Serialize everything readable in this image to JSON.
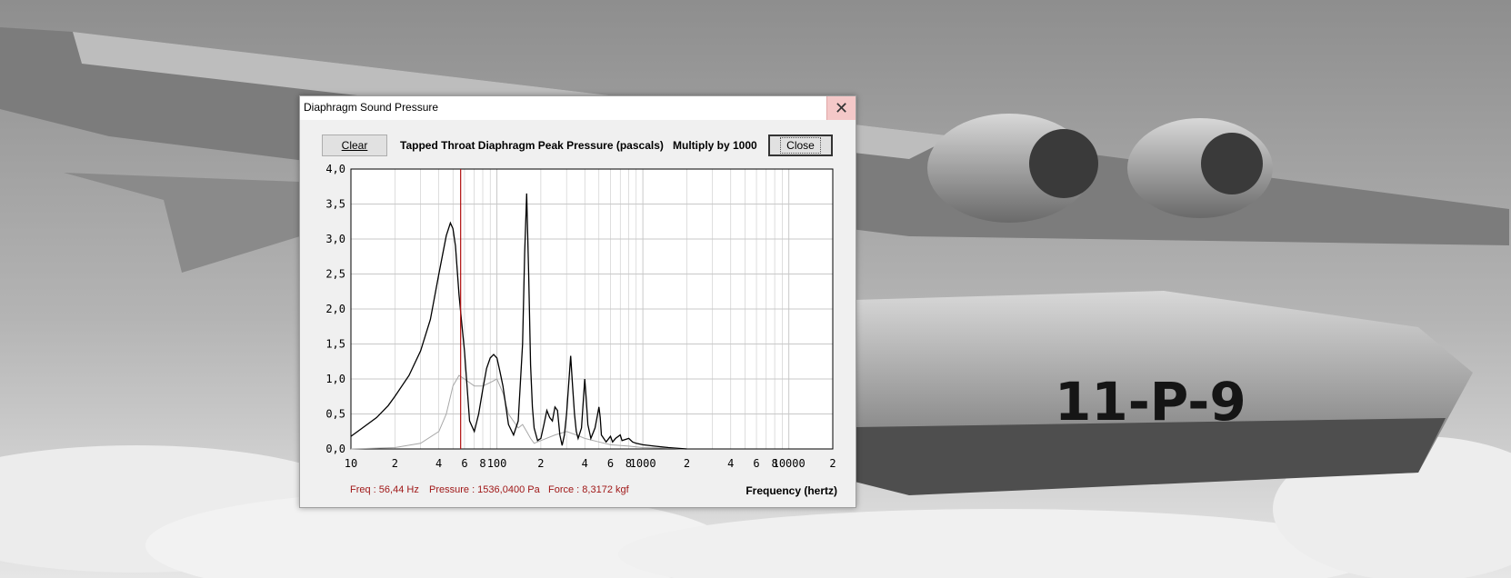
{
  "window": {
    "title": "Diaphragm Sound Pressure",
    "close_glyph": "✕"
  },
  "toolbar": {
    "clear_label": "Clear",
    "close_label": "Close",
    "chart_title": "Tapped Throat Diaphragm Peak Pressure (pascals)",
    "multiply_note": "Multiply by 1000"
  },
  "readouts": {
    "freq": "Freq : 56,44 Hz",
    "pressure": "Pressure : 1536,0400 Pa",
    "force": "Force : 8,3172 kgf"
  },
  "background": {
    "aircraft_marking": "11-P-9"
  },
  "chart_data": {
    "type": "line",
    "xscale": "log",
    "xlabel": "Frequency (hertz)",
    "xlim": [
      10,
      20000
    ],
    "ylim": [
      0,
      4
    ],
    "yticks": [
      "0,0",
      "0,5",
      "1,0",
      "1,5",
      "2,0",
      "2,5",
      "3,0",
      "3,5",
      "4,0"
    ],
    "yticks_values": [
      0,
      0.5,
      1,
      1.5,
      2,
      2.5,
      3,
      3.5,
      4
    ],
    "xticks": [
      {
        "v": 10,
        "label": "10"
      },
      {
        "v": 20,
        "label": "2"
      },
      {
        "v": 40,
        "label": "4"
      },
      {
        "v": 60,
        "label": "6"
      },
      {
        "v": 80,
        "label": "8"
      },
      {
        "v": 100,
        "label": "100"
      },
      {
        "v": 200,
        "label": "2"
      },
      {
        "v": 400,
        "label": "4"
      },
      {
        "v": 600,
        "label": "6"
      },
      {
        "v": 800,
        "label": "8"
      },
      {
        "v": 1000,
        "label": "1000"
      },
      {
        "v": 2000,
        "label": "2"
      },
      {
        "v": 4000,
        "label": "4"
      },
      {
        "v": 6000,
        "label": "6"
      },
      {
        "v": 8000,
        "label": "8"
      },
      {
        "v": 10000,
        "label": "10000"
      },
      {
        "v": 20000,
        "label": "2"
      }
    ],
    "cursor_freq": 56.44,
    "colors": {
      "main": "#000000",
      "secondary": "#a8a8a8",
      "cursor": "#b01010",
      "grid": "#c8c8c8"
    },
    "series": [
      {
        "color": "#000000",
        "x": [
          10,
          12,
          15,
          18,
          20,
          25,
          30,
          35,
          40,
          45,
          48,
          50,
          52,
          55,
          58,
          60,
          65,
          70,
          75,
          80,
          85,
          90,
          95,
          100,
          105,
          110,
          120,
          130,
          140,
          150,
          155,
          160,
          165,
          170,
          175,
          180,
          190,
          200,
          210,
          220,
          230,
          240,
          250,
          260,
          270,
          280,
          290,
          300,
          320,
          330,
          340,
          350,
          360,
          380,
          400,
          410,
          420,
          440,
          470,
          490,
          500,
          510,
          520,
          560,
          600,
          620,
          650,
          700,
          720,
          800,
          850,
          900,
          1000,
          1200,
          1500,
          2000
        ],
        "y": [
          0.18,
          0.3,
          0.45,
          0.62,
          0.75,
          1.05,
          1.4,
          1.85,
          2.5,
          3.05,
          3.23,
          3.15,
          2.9,
          2.2,
          1.7,
          1.4,
          0.4,
          0.25,
          0.5,
          0.85,
          1.15,
          1.3,
          1.35,
          1.3,
          1.1,
          0.9,
          0.35,
          0.2,
          0.4,
          1.5,
          2.8,
          3.65,
          2.5,
          1.2,
          0.6,
          0.3,
          0.12,
          0.15,
          0.35,
          0.55,
          0.45,
          0.4,
          0.6,
          0.55,
          0.2,
          0.05,
          0.2,
          0.5,
          1.33,
          0.9,
          0.5,
          0.25,
          0.15,
          0.3,
          1.0,
          0.7,
          0.35,
          0.15,
          0.3,
          0.5,
          0.6,
          0.45,
          0.2,
          0.1,
          0.18,
          0.1,
          0.15,
          0.2,
          0.12,
          0.15,
          0.1,
          0.08,
          0.06,
          0.04,
          0.02,
          0.0
        ]
      },
      {
        "color": "#a8a8a8",
        "x": [
          10,
          20,
          30,
          40,
          45,
          50,
          55,
          60,
          70,
          80,
          90,
          100,
          110,
          120,
          140,
          150,
          160,
          170,
          180,
          200,
          250,
          300,
          350,
          400,
          500,
          600,
          800,
          1000,
          1500,
          2000
        ],
        "y": [
          0.0,
          0.02,
          0.08,
          0.25,
          0.5,
          0.9,
          1.05,
          1.0,
          0.9,
          0.9,
          0.95,
          1.0,
          0.8,
          0.5,
          0.3,
          0.35,
          0.25,
          0.15,
          0.08,
          0.12,
          0.2,
          0.25,
          0.2,
          0.15,
          0.1,
          0.06,
          0.04,
          0.02,
          0.01,
          0.0
        ]
      }
    ]
  }
}
